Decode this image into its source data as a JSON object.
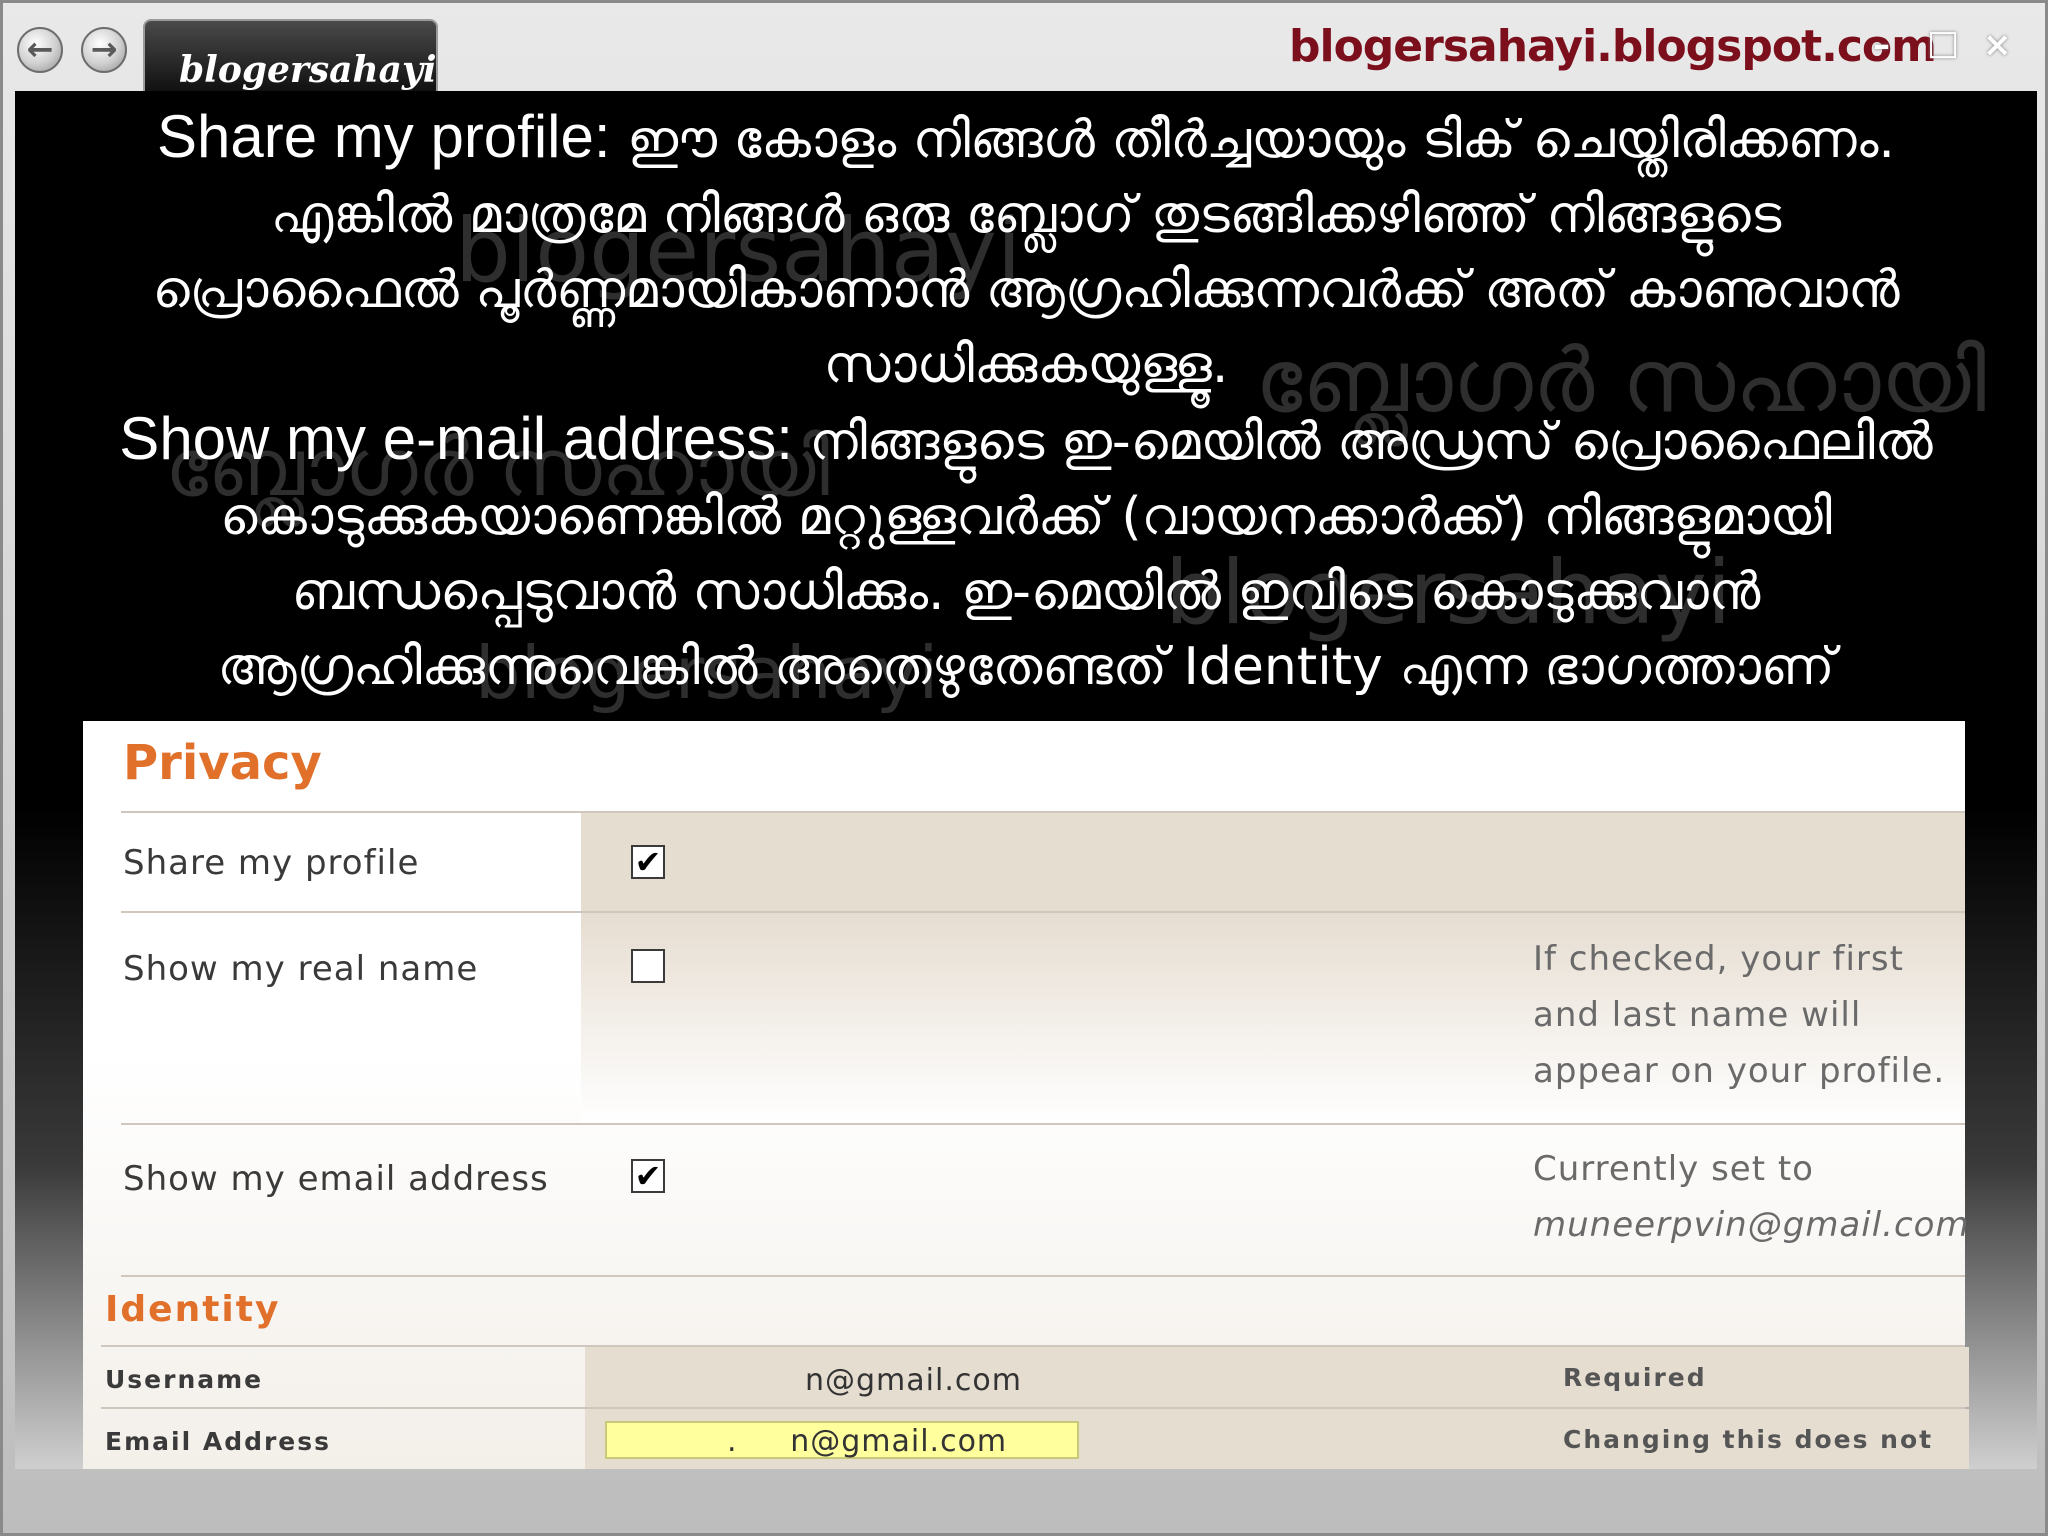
{
  "window": {
    "tab_title": "blogersahayi",
    "site_title": "blogersahayi.blogspot.com",
    "back_icon": "back-arrow-icon",
    "forward_icon": "forward-arrow-icon"
  },
  "watermarks": [
    "blogersahayi",
    "ബ്ലോഗർ സഹായി",
    "ബ്ലോഗർ സഹായി",
    "blogersahayi",
    "blogersahayi"
  ],
  "text": {
    "share_label": "Share my profile:",
    "share_body_1": " ഈ കോളം നിങ്ങൾ തീർച്ചയായും ടിക് ചെയ്തിരിക്കണം.",
    "share_body_2": "എങ്കിൽ മാത്രമേ നിങ്ങൾ ഒരു ബ്ലോഗ് തുടങ്ങിക്കഴിഞ്ഞ് നിങ്ങളുടെ",
    "share_body_3": "പ്രൊഫൈൽ പൂർണ്ണമായികാണാൻ ആഗ്രഹിക്കുന്നവർക്ക് അത് കാണുവാൻ",
    "share_body_4": "സാധിക്കുകയുള്ളൂ.",
    "email_label": "Show my e-mail address:",
    "email_body_1": " നിങ്ങളുടെ ഇ-മെയിൽ അഡ്രസ് പ്രൊഫൈലിൽ",
    "email_body_2": "കൊടുക്കുകയാണെങ്കിൽ മറ്റുള്ളവർക്ക് (വായനക്കാർക്ക്) നിങ്ങളുമായി",
    "email_body_3": "ബന്ധപ്പെടുവാൻ സാധിക്കും. ഇ-മെയിൽ ഇവിടെ കൊടുക്കുവാൻ",
    "email_body_4": "ആഗ്രഹിക്കുന്നുവെങ്കിൽ അതെഴുതേണ്ടത് Identity എന്ന ഭാഗത്താണ്"
  },
  "privacy": {
    "title": "Privacy",
    "rows": [
      {
        "label": "Share my profile",
        "checked": true,
        "hint_lines": []
      },
      {
        "label": "Show my real name",
        "checked": false,
        "hint_lines": [
          "If checked, your first",
          "and last name will",
          "appear on your profile."
        ]
      },
      {
        "label": "Show my email address",
        "checked": true,
        "hint_lines": [
          "Currently set to",
          "muneerpvin@gmail.com"
        ]
      }
    ],
    "check_mark": "✔"
  },
  "identity": {
    "title": "Identity",
    "username_label": "Username",
    "username_value": "n@gmail.com",
    "username_note": "Required",
    "email_label": "Email Address",
    "email_value": ".     n@gmail.com",
    "email_note": "Changing this does not"
  }
}
